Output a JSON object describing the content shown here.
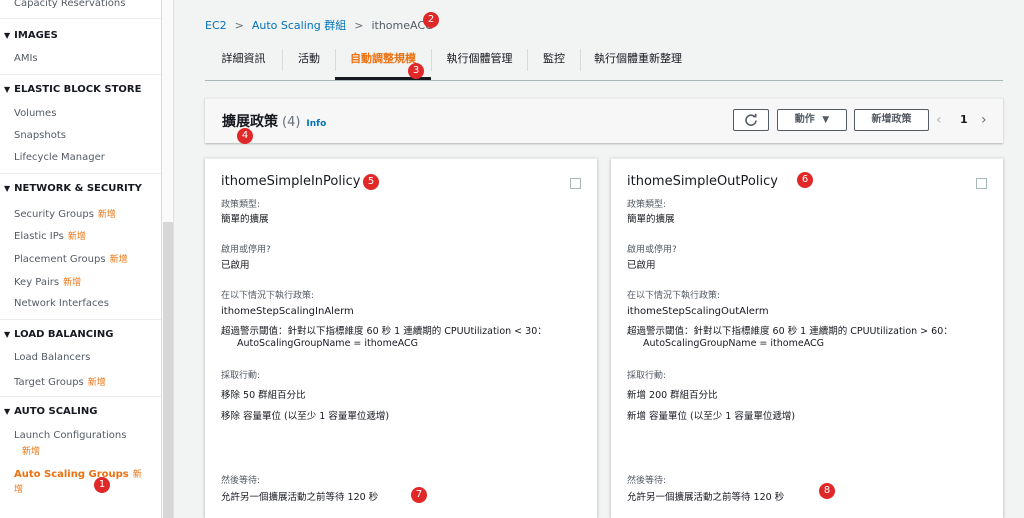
{
  "sidebar": {
    "capacity_reservations": "Capacity Reservations",
    "sections": {
      "images": "IMAGES",
      "ebs": "ELASTIC BLOCK STORE",
      "network": "NETWORK & SECURITY",
      "lb": "LOAD BALANCING",
      "autoscaling": "AUTO SCALING"
    },
    "items": {
      "amis": "AMIs",
      "volumes": "Volumes",
      "snapshots": "Snapshots",
      "lifecycle": "Lifecycle Manager",
      "security_groups": "Security Groups",
      "elastic_ips": "Elastic IPs",
      "placement_groups": "Placement Groups",
      "key_pairs": "Key Pairs",
      "network_interfaces": "Network Interfaces",
      "load_balancers": "Load Balancers",
      "target_groups": "Target Groups",
      "launch_configs": "Launch Configurations",
      "asg_line1": "Auto Scaling Groups",
      "asg_line2": "增"
    },
    "new_badge": "新增",
    "new_badge_short": "新"
  },
  "breadcrumb": {
    "ec2": "EC2",
    "asg": "Auto Scaling 群組",
    "current": "ithomeACG"
  },
  "tabs": [
    "詳細資訊",
    "活動",
    "自動調整規模",
    "執行個體管理",
    "監控",
    "執行個體重新整理"
  ],
  "policies_header": {
    "title": "擴展政策",
    "count": "(4)",
    "info": "Info",
    "actions_label": "動作",
    "add_policy_label": "新增政策",
    "page": "1"
  },
  "cards": [
    {
      "title": "ithomeSimpleInPolicy",
      "policy_type_label": "政策類型:",
      "policy_type": "簡單的擴展",
      "enabled_label": "啟用或停用?",
      "enabled": "已啟用",
      "execute_label": "在以下情況下執行政策:",
      "alarm_name": "ithomeStepScalingInAlerm",
      "alarm_desc": "超過警示閾值：針對以下指標維度 60 秒 1 連續期的 CPUUtilization < 30：",
      "alarm_dim": "AutoScalingGroupName = ithomeACG",
      "action_label": "採取行動:",
      "action_1": "移除 50 群組百分比",
      "action_2": "移除 容量單位 (以至少 1 容量單位遞增)",
      "wait_label": "然後等待:",
      "wait": "允許另一個擴展活動之前等待 120 秒"
    },
    {
      "title": "ithomeSimpleOutPolicy",
      "policy_type_label": "政策類型:",
      "policy_type": "簡單的擴展",
      "enabled_label": "啟用或停用?",
      "enabled": "已啟用",
      "execute_label": "在以下情況下執行政策:",
      "alarm_name": "ithomeStepScalingOutAlerm",
      "alarm_desc": "超過警示閾值：針對以下指標維度 60 秒 1 連續期的 CPUUtilization > 60：",
      "alarm_dim": "AutoScalingGroupName = ithomeACG",
      "action_label": "採取行動:",
      "action_1": "新增 200 群組百分比",
      "action_2": "新增 容量單位 (以至少 1 容量單位遞增)",
      "wait_label": "然後等待:",
      "wait": "允許另一個擴展活動之前等待 120 秒"
    }
  ],
  "annotations": [
    "1",
    "2",
    "3",
    "4",
    "5",
    "6",
    "7",
    "8"
  ],
  "colors": {
    "accent": "#ec7211",
    "link": "#0073bb",
    "badge": "#e02828"
  }
}
